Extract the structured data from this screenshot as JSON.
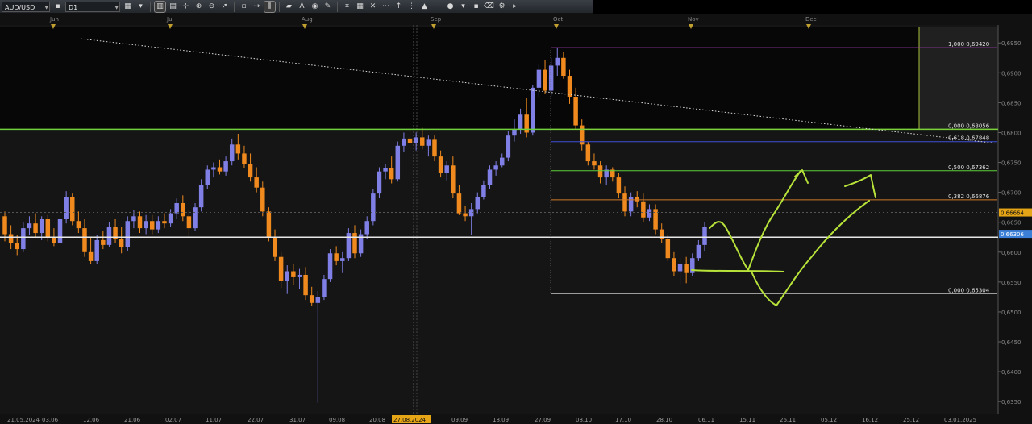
{
  "toolbar": {
    "symbol": "AUD/USD",
    "timeframe": "D1",
    "buttons": [
      "chart-type-icon",
      "bars-icon",
      "crosshair-icon",
      "zoom-in-icon",
      "zoom-out-icon",
      "cursor-icon",
      "dot-icon",
      "line-icon",
      "text-icon",
      "draw-icon",
      "pencil-icon",
      "fib-icon",
      "wave-icon",
      "grid-icon",
      "vertical-line-icon",
      "period-icon",
      "circle-icon",
      "color-icon",
      "eraser-icon",
      "tools-icon"
    ]
  },
  "chart_data": {
    "type": "candlestick",
    "symbol": "AUD/USD",
    "timeframe": "D1",
    "ylim": [
      0.633,
      0.698
    ],
    "y_ticks": [
      "0,6950",
      "0,6900",
      "0,6850",
      "0,6800",
      "0,6750",
      "0,6700",
      "0,6650",
      "0,6600",
      "0,6550",
      "0,6500",
      "0,6450",
      "0,6400",
      "0,6350"
    ],
    "month_labels": [
      "Jun",
      "Jul",
      "Aug",
      "Sep",
      "Oct",
      "Nov",
      "Dec"
    ],
    "date_labels": [
      "21.05.2024",
      "03.06",
      "12.06",
      "21.06",
      "02.07",
      "11.07",
      "22.07",
      "31.07",
      "09.08",
      "20.08",
      "27.08.2024",
      "09.09",
      "18.09",
      "27.09",
      "08.10",
      "17.10",
      "28.10",
      "06.11",
      "15.11",
      "26.11",
      "05.12",
      "16.12",
      "25.12",
      "03.01.2025"
    ],
    "highlighted_date": "27.08.2024",
    "bid_price": 0.66306,
    "ask_price": 0.66664,
    "bid_label": "0,66306",
    "ask_label": "0,66664",
    "horizontal_lines": [
      {
        "price": 0.6625,
        "color": "#e6e6e6"
      },
      {
        "price": 0.68056,
        "color": "#6fd23c"
      }
    ],
    "fibonacci": [
      {
        "label": "1,000 0,69420",
        "price": 0.6942,
        "color": "#a23bb0"
      },
      {
        "label": "0,000 0,68056",
        "price": 0.68056,
        "color": "#7fcf3a"
      },
      {
        "label": "0,618 0,67848",
        "price": 0.67848,
        "color": "#3f4fd8"
      },
      {
        "label": "0,500 0,67362",
        "price": 0.67362,
        "color": "#5fcf3a"
      },
      {
        "label": "0,382 0,66876",
        "price": 0.66876,
        "color": "#d07a2a"
      },
      {
        "label": "0,000 0,65304",
        "price": 0.65304,
        "color": "#b0b0b0"
      }
    ],
    "candles": [
      [
        0.666,
        0.6668,
        0.6618,
        0.663
      ],
      [
        0.663,
        0.6645,
        0.6605,
        0.6615
      ],
      [
        0.6615,
        0.6628,
        0.6595,
        0.6605
      ],
      [
        0.6605,
        0.665,
        0.66,
        0.664
      ],
      [
        0.664,
        0.666,
        0.6628,
        0.6648
      ],
      [
        0.6648,
        0.6665,
        0.6625,
        0.6632
      ],
      [
        0.6632,
        0.666,
        0.662,
        0.6655
      ],
      [
        0.6655,
        0.6662,
        0.6618,
        0.6625
      ],
      [
        0.6625,
        0.664,
        0.661,
        0.6615
      ],
      [
        0.6615,
        0.6662,
        0.6612,
        0.6655
      ],
      [
        0.6655,
        0.6702,
        0.6648,
        0.6692
      ],
      [
        0.6692,
        0.6698,
        0.6645,
        0.6652
      ],
      [
        0.6652,
        0.6668,
        0.6632,
        0.664
      ],
      [
        0.664,
        0.6655,
        0.6592,
        0.66
      ],
      [
        0.66,
        0.6625,
        0.658,
        0.6585
      ],
      [
        0.6585,
        0.6628,
        0.658,
        0.662
      ],
      [
        0.662,
        0.6635,
        0.6605,
        0.6612
      ],
      [
        0.6612,
        0.665,
        0.6608,
        0.6642
      ],
      [
        0.6642,
        0.6655,
        0.6615,
        0.6622
      ],
      [
        0.6622,
        0.6642,
        0.6598,
        0.6608
      ],
      [
        0.6608,
        0.666,
        0.6602,
        0.6652
      ],
      [
        0.6652,
        0.667,
        0.664,
        0.666
      ],
      [
        0.666,
        0.6668,
        0.6632,
        0.664
      ],
      [
        0.664,
        0.6662,
        0.663,
        0.6652
      ],
      [
        0.6652,
        0.6662,
        0.663,
        0.6638
      ],
      [
        0.6638,
        0.666,
        0.6632,
        0.6652
      ],
      [
        0.6652,
        0.6665,
        0.664,
        0.6648
      ],
      [
        0.6648,
        0.6672,
        0.6642,
        0.6665
      ],
      [
        0.6665,
        0.669,
        0.6655,
        0.6682
      ],
      [
        0.6682,
        0.6695,
        0.6652,
        0.666
      ],
      [
        0.666,
        0.667,
        0.6625,
        0.664
      ],
      [
        0.664,
        0.6682,
        0.6635,
        0.6675
      ],
      [
        0.6675,
        0.6722,
        0.6668,
        0.6712
      ],
      [
        0.6712,
        0.6745,
        0.6705,
        0.6738
      ],
      [
        0.6738,
        0.675,
        0.6725,
        0.6742
      ],
      [
        0.6742,
        0.6755,
        0.673,
        0.6735
      ],
      [
        0.6735,
        0.676,
        0.6728,
        0.6752
      ],
      [
        0.6752,
        0.679,
        0.6745,
        0.678
      ],
      [
        0.678,
        0.6798,
        0.6755,
        0.6765
      ],
      [
        0.6765,
        0.6778,
        0.674,
        0.6748
      ],
      [
        0.6748,
        0.6765,
        0.6718,
        0.6725
      ],
      [
        0.6725,
        0.6742,
        0.67,
        0.6708
      ],
      [
        0.6708,
        0.6718,
        0.666,
        0.6668
      ],
      [
        0.6668,
        0.6675,
        0.6618,
        0.6625
      ],
      [
        0.6625,
        0.6638,
        0.6585,
        0.6592
      ],
      [
        0.6592,
        0.66,
        0.654,
        0.6552
      ],
      [
        0.6552,
        0.6578,
        0.653,
        0.6568
      ],
      [
        0.6568,
        0.658,
        0.6545,
        0.6558
      ],
      [
        0.6558,
        0.6572,
        0.6538,
        0.6562
      ],
      [
        0.6562,
        0.6575,
        0.652,
        0.6528
      ],
      [
        0.6528,
        0.6542,
        0.651,
        0.6515
      ],
      [
        0.6515,
        0.6535,
        0.6348,
        0.6525
      ],
      [
        0.6525,
        0.6562,
        0.652,
        0.6555
      ],
      [
        0.6555,
        0.6605,
        0.655,
        0.6598
      ],
      [
        0.6598,
        0.661,
        0.6578,
        0.6585
      ],
      [
        0.6585,
        0.66,
        0.6565,
        0.659
      ],
      [
        0.659,
        0.664,
        0.6585,
        0.6632
      ],
      [
        0.6632,
        0.6645,
        0.659,
        0.6598
      ],
      [
        0.6598,
        0.6638,
        0.6592,
        0.663
      ],
      [
        0.663,
        0.666,
        0.6622,
        0.6652
      ],
      [
        0.6652,
        0.6705,
        0.6645,
        0.6698
      ],
      [
        0.6698,
        0.6742,
        0.669,
        0.6735
      ],
      [
        0.6735,
        0.6748,
        0.6722,
        0.674
      ],
      [
        0.674,
        0.676,
        0.6715,
        0.6722
      ],
      [
        0.6722,
        0.6785,
        0.6718,
        0.6778
      ],
      [
        0.6778,
        0.68,
        0.6768,
        0.679
      ],
      [
        0.679,
        0.6805,
        0.6772,
        0.6782
      ],
      [
        0.6782,
        0.68,
        0.677,
        0.6792
      ],
      [
        0.6792,
        0.6808,
        0.6772,
        0.6778
      ],
      [
        0.6778,
        0.6795,
        0.676,
        0.6788
      ],
      [
        0.6788,
        0.6795,
        0.6752,
        0.676
      ],
      [
        0.676,
        0.677,
        0.6725,
        0.6732
      ],
      [
        0.6732,
        0.6752,
        0.672,
        0.6745
      ],
      [
        0.6745,
        0.676,
        0.669,
        0.6698
      ],
      [
        0.6698,
        0.6712,
        0.6662,
        0.6665
      ],
      [
        0.6665,
        0.6678,
        0.6652,
        0.666
      ],
      [
        0.666,
        0.6682,
        0.6628,
        0.6672
      ],
      [
        0.6672,
        0.67,
        0.6665,
        0.6692
      ],
      [
        0.6692,
        0.672,
        0.6688,
        0.6712
      ],
      [
        0.6712,
        0.6745,
        0.6705,
        0.6738
      ],
      [
        0.6738,
        0.6752,
        0.6728,
        0.6745
      ],
      [
        0.6745,
        0.6765,
        0.6742,
        0.6758
      ],
      [
        0.6758,
        0.6802,
        0.6752,
        0.6795
      ],
      [
        0.6795,
        0.6822,
        0.6785,
        0.6805
      ],
      [
        0.6805,
        0.684,
        0.6798,
        0.683
      ],
      [
        0.683,
        0.6858,
        0.6792,
        0.68
      ],
      [
        0.68,
        0.688,
        0.6795,
        0.6875
      ],
      [
        0.6875,
        0.6915,
        0.686,
        0.6905
      ],
      [
        0.6905,
        0.6922,
        0.6865,
        0.687
      ],
      [
        0.687,
        0.6925,
        0.6862,
        0.6912
      ],
      [
        0.6912,
        0.6942,
        0.6895,
        0.6925
      ],
      [
        0.6925,
        0.6935,
        0.689,
        0.6895
      ],
      [
        0.6895,
        0.6905,
        0.6848,
        0.686
      ],
      [
        0.686,
        0.6875,
        0.6805,
        0.6812
      ],
      [
        0.6812,
        0.6822,
        0.677,
        0.678
      ],
      [
        0.678,
        0.6785,
        0.6745,
        0.6752
      ],
      [
        0.6752,
        0.6765,
        0.6738,
        0.6745
      ],
      [
        0.6745,
        0.6752,
        0.6715,
        0.6725
      ],
      [
        0.6725,
        0.6745,
        0.6712,
        0.6738
      ],
      [
        0.6738,
        0.6742,
        0.6718,
        0.6725
      ],
      [
        0.6725,
        0.6732,
        0.669,
        0.6698
      ],
      [
        0.6698,
        0.671,
        0.666,
        0.6668
      ],
      [
        0.6668,
        0.67,
        0.666,
        0.6692
      ],
      [
        0.6692,
        0.6702,
        0.6675,
        0.6685
      ],
      [
        0.6685,
        0.6698,
        0.665,
        0.6658
      ],
      [
        0.6658,
        0.668,
        0.6652,
        0.6672
      ],
      [
        0.6672,
        0.668,
        0.663,
        0.6638
      ],
      [
        0.6638,
        0.6648,
        0.6615,
        0.6622
      ],
      [
        0.6622,
        0.663,
        0.6585,
        0.659
      ],
      [
        0.659,
        0.66,
        0.656,
        0.6568
      ],
      [
        0.6568,
        0.659,
        0.6545,
        0.658
      ],
      [
        0.658,
        0.6592,
        0.6548,
        0.6565
      ],
      [
        0.6565,
        0.6598,
        0.656,
        0.659
      ],
      [
        0.659,
        0.662,
        0.6585,
        0.6612
      ],
      [
        0.6612,
        0.665,
        0.6602,
        0.6642
      ]
    ]
  },
  "annotations": {
    "arrow_color": "#b7e23a",
    "trend_line_color": "#e6e6e6",
    "price_scale": [
      "0,6950",
      "0,6900",
      "0,6850",
      "0,6800",
      "0,6750",
      "0,6700",
      "0,6650",
      "0,6600",
      "0,6550",
      "0,6500",
      "0,6450",
      "0,6400",
      "0,6350"
    ]
  }
}
